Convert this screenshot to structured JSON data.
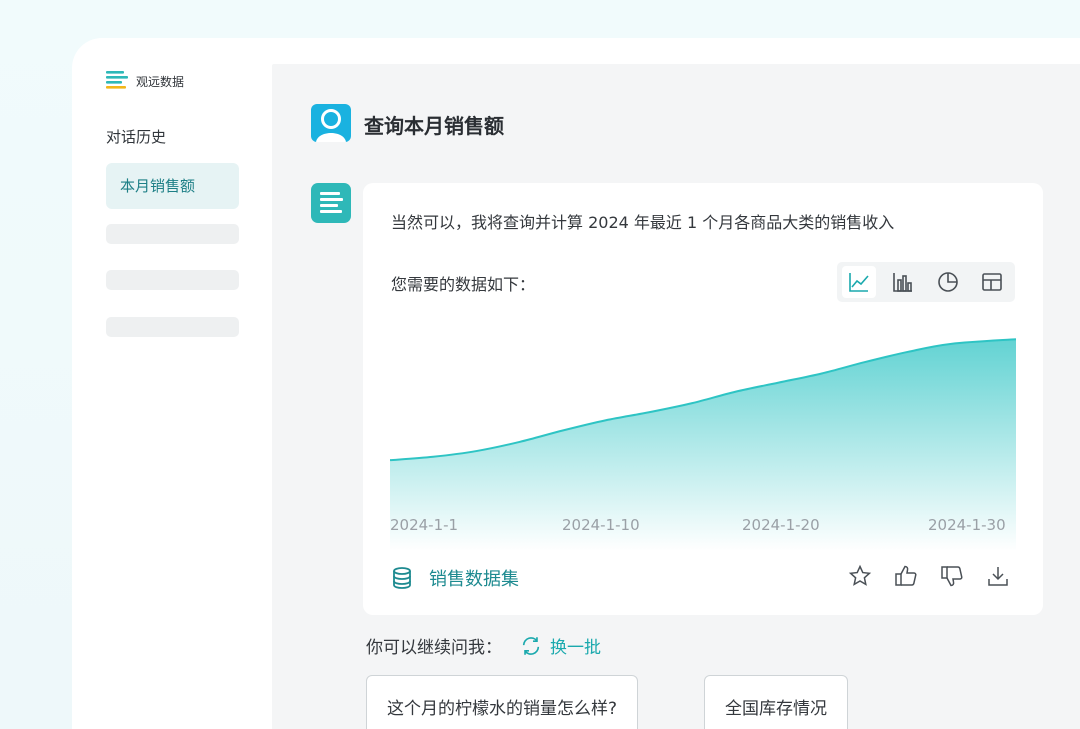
{
  "brand": {
    "name": "观远数据"
  },
  "sidebar": {
    "history_title": "对话历史",
    "active_item": "本月销售额"
  },
  "conversation": {
    "question": "查询本月销售额",
    "answer": "当然可以，我将查询并计算 2024 年最近 1 个月各商品大类的销售收入",
    "data_intro": "您需要的数据如下：",
    "chart_tools": [
      {
        "icon": "line-chart-icon",
        "active": true
      },
      {
        "icon": "bar-chart-icon",
        "active": false
      },
      {
        "icon": "pie-chart-icon",
        "active": false
      },
      {
        "icon": "table-icon",
        "active": false
      }
    ],
    "dataset_label": "销售数据集",
    "actions": [
      "star-icon",
      "thumbs-up-icon",
      "thumbs-down-icon",
      "download-icon"
    ]
  },
  "followup": {
    "label": "你可以继续问我：",
    "refresh_label": "换一批",
    "suggestions": [
      "这个月的柠檬水的销量怎么样?",
      "全国库存情况"
    ]
  },
  "colors": {
    "accent": "#1aa9ad",
    "line": "#2ec4c4",
    "avatar_user": "#1ab2e0",
    "avatar_bot": "#2eb8b8"
  },
  "chart_data": {
    "type": "area",
    "x_tick_labels": [
      "2024-1-1",
      "2024-1-10",
      "2024-1-20",
      "2024-1-30"
    ],
    "x": [
      1,
      3,
      5,
      7,
      9,
      11,
      13,
      15,
      17,
      19,
      21,
      23,
      25,
      27,
      30
    ],
    "values": [
      20,
      23,
      28,
      36,
      46,
      55,
      62,
      70,
      80,
      88,
      96,
      106,
      115,
      122,
      126
    ],
    "ylim": [
      0,
      135
    ],
    "grid": false,
    "legend": "none"
  }
}
